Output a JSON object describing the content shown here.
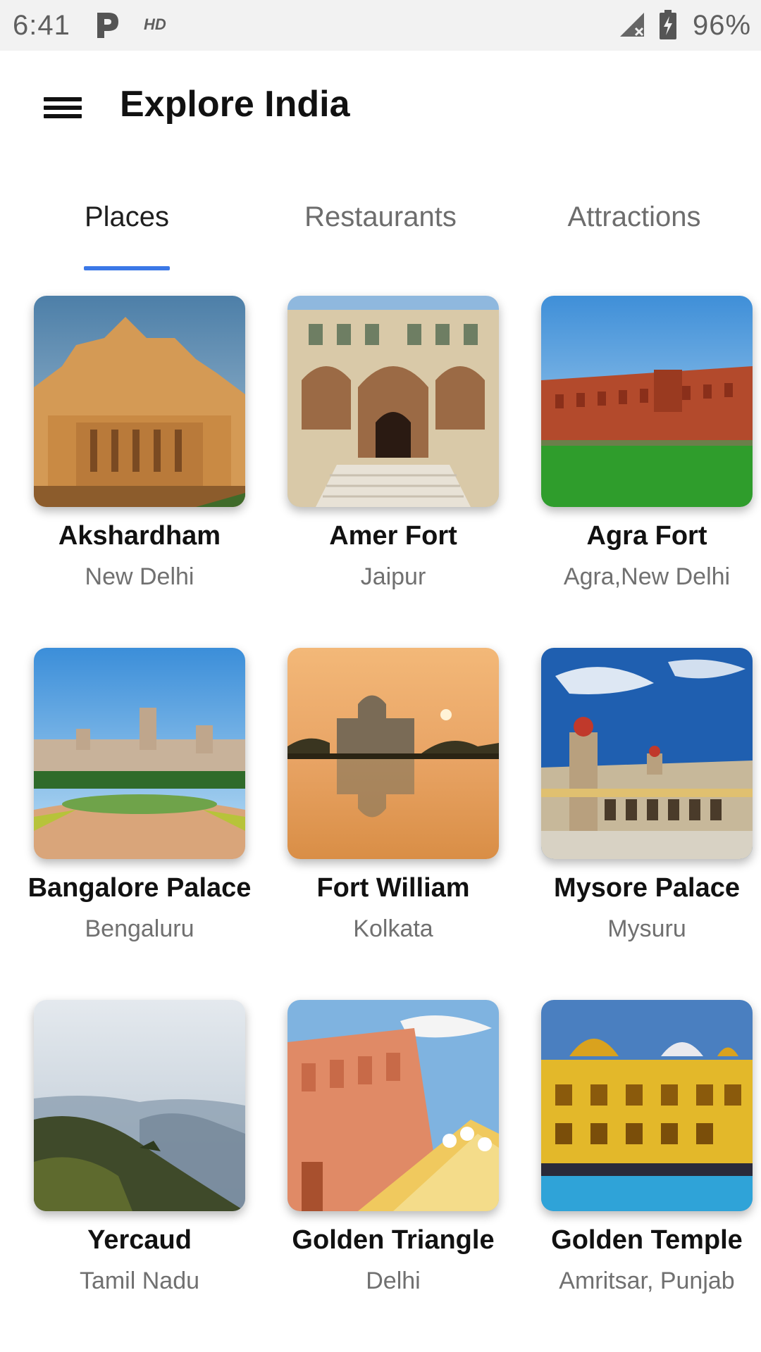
{
  "status_bar": {
    "time": "6:41",
    "network_label": "HD",
    "battery_percent": "96%",
    "icons": [
      "parking-icon",
      "signal-icon",
      "battery-charging-icon"
    ]
  },
  "app_bar": {
    "title": "Explore India",
    "menu_icon": "hamburger-menu-icon"
  },
  "tabs": [
    {
      "label": "Places",
      "active": true
    },
    {
      "label": "Restaurants",
      "active": false
    },
    {
      "label": "Attractions",
      "active": false
    }
  ],
  "accent_color": "#3b78e7",
  "places": [
    {
      "name": "Akshardham",
      "location": "New Delhi"
    },
    {
      "name": "Amer Fort",
      "location": "Jaipur"
    },
    {
      "name": "Agra Fort",
      "location": "Agra,New Delhi"
    },
    {
      "name": "Bangalore Palace",
      "location": "Bengaluru"
    },
    {
      "name": "Fort William",
      "location": "Kolkata"
    },
    {
      "name": "Mysore Palace",
      "location": "Mysuru"
    },
    {
      "name": "Yercaud",
      "location": "Tamil Nadu"
    },
    {
      "name": "Golden Triangle",
      "location": "Delhi"
    },
    {
      "name": "Golden Temple",
      "location": "Amritsar, Punjab"
    }
  ]
}
